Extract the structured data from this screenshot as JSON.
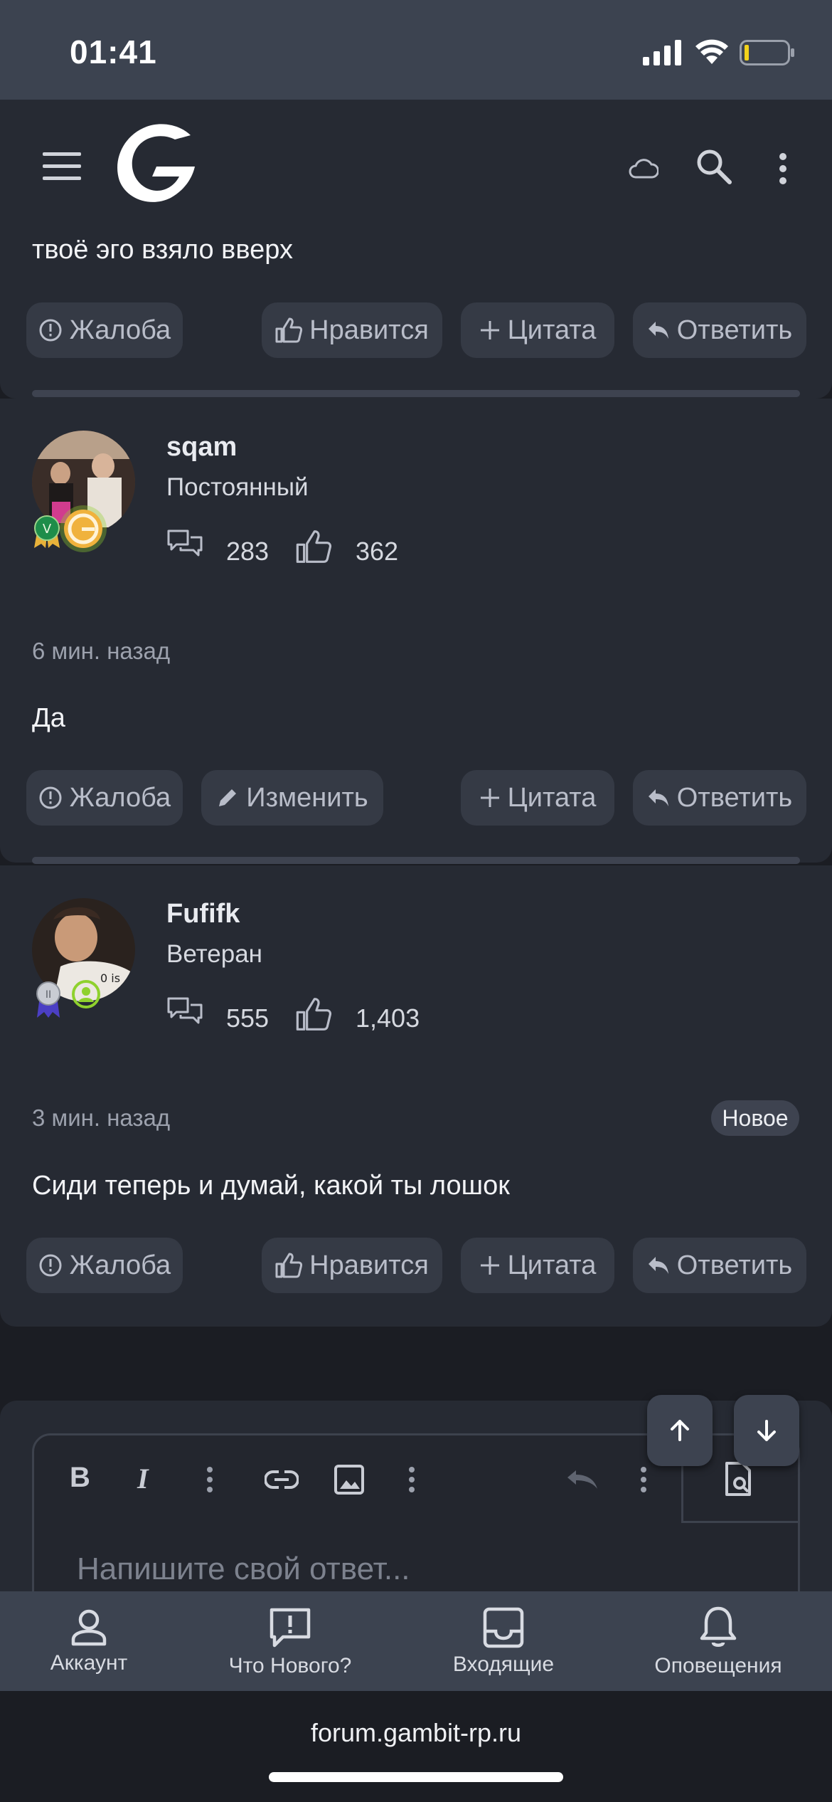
{
  "status_bar": {
    "time": "01:41"
  },
  "header": {
    "icons": [
      "menu-icon",
      "gambit-logo",
      "cloud-icon",
      "search-icon",
      "more-vertical-icon"
    ]
  },
  "posts": [
    {
      "text": "твоё эго взяло вверх",
      "actions": {
        "report": "Жалоба",
        "like": "Нравится",
        "quote": "Цитата",
        "reply": "Ответить"
      }
    },
    {
      "username": "sqam",
      "rank": "Постоянный",
      "messages": "283",
      "reactions": "362",
      "time": "6 мин. назад",
      "text": "Да",
      "actions": {
        "report": "Жалоба",
        "edit": "Изменить",
        "quote": "Цитата",
        "reply": "Ответить"
      }
    },
    {
      "username": "Fufifk",
      "rank": "Ветеран",
      "messages": "555",
      "reactions": "1,403",
      "time": "3 мин. назад",
      "badge": "Новое",
      "text": "Сиди теперь и думай, какой ты лошок",
      "actions": {
        "report": "Жалоба",
        "like": "Нравится",
        "quote": "Цитата",
        "reply": "Ответить"
      }
    }
  ],
  "editor": {
    "placeholder": "Напишите свой ответ...",
    "toolbar": [
      "bold-icon",
      "italic-icon",
      "more-icon",
      "link-icon",
      "image-icon",
      "more-icon",
      "undo-icon",
      "more-icon",
      "preview-icon"
    ]
  },
  "bottom_nav": [
    {
      "label": "Аккаунт",
      "icon": "account-icon"
    },
    {
      "label": "Что Нового?",
      "icon": "whats-new-icon"
    },
    {
      "label": "Входящие",
      "icon": "inbox-icon"
    },
    {
      "label": "Оповещения",
      "icon": "bell-icon"
    }
  ],
  "browser": {
    "url": "forum.gambit-rp.ru"
  },
  "colors": {
    "background": "#1b1d23",
    "panel": "#262a33",
    "button": "#353a45",
    "bar": "#3c4350",
    "accent_gold": "#e8b23a",
    "accent_green": "#8fd12e"
  }
}
